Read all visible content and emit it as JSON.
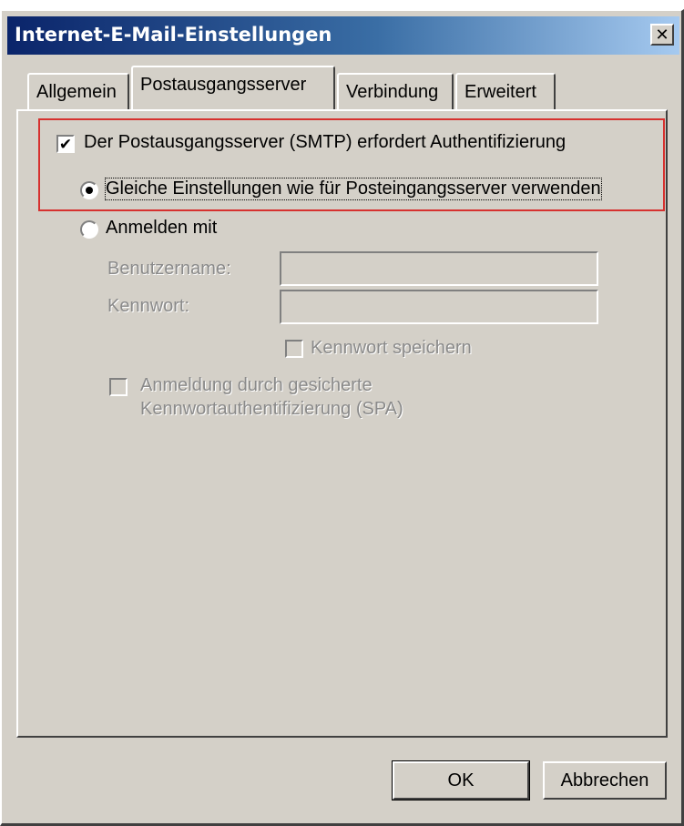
{
  "window": {
    "title": "Internet-E-Mail-Einstellungen",
    "close_glyph": "✕"
  },
  "tabs": [
    {
      "label": "Allgemein",
      "active": false
    },
    {
      "label": "Postausgangsserver",
      "active": true
    },
    {
      "label": "Verbindung",
      "active": false
    },
    {
      "label": "Erweitert",
      "active": false
    }
  ],
  "smtp_auth": {
    "checkbox_label": "Der Postausgangsserver (SMTP) erfordert Authentifizierung",
    "checked": true,
    "check_glyph": "✔",
    "option_same": "Gleiche Einstellungen wie für Posteingangsserver verwenden",
    "option_same_selected": true,
    "option_login": "Anmelden mit",
    "option_login_selected": false
  },
  "login": {
    "username_label": "Benutzername:",
    "username_value": "",
    "password_label": "Kennwort:",
    "password_value": "",
    "save_password_label": "Kennwort speichern",
    "spa_label_line1": "Anmeldung durch gesicherte",
    "spa_label_line2": "Kennwortauthentifizierung (SPA)"
  },
  "buttons": {
    "ok": "OK",
    "cancel": "Abbrechen"
  },
  "colors": {
    "highlight": "#d6312f",
    "titlebar_start": "#0a246a",
    "titlebar_end": "#a6caf0",
    "dialog_bg": "#d4d0c8"
  }
}
